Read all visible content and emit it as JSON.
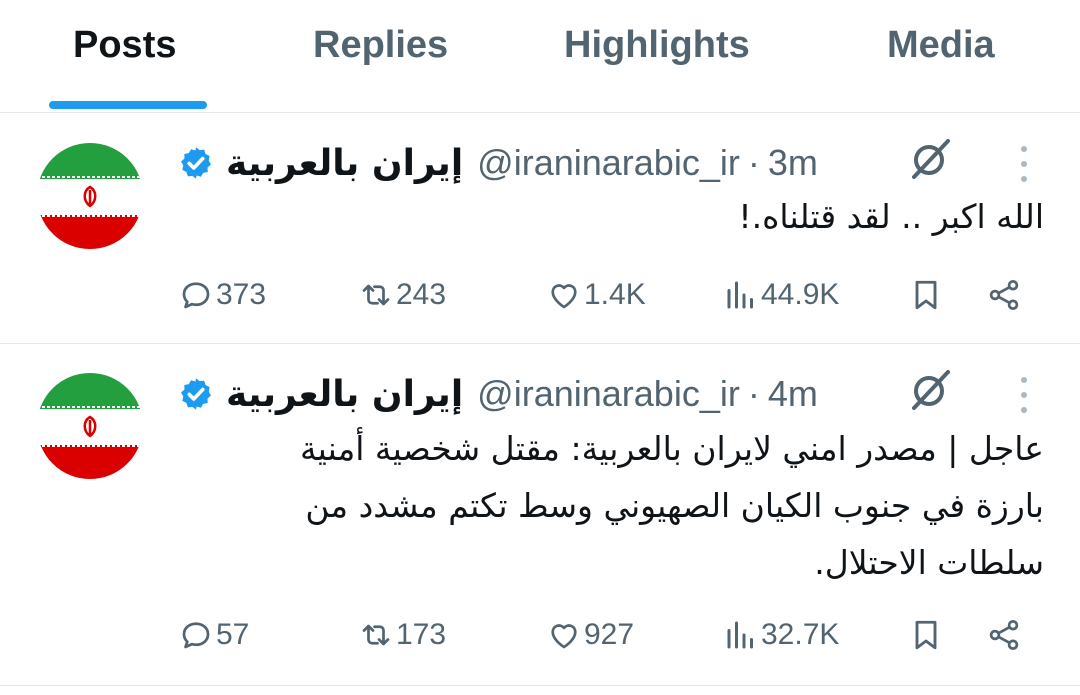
{
  "tabs": [
    {
      "label": "Posts",
      "active": true
    },
    {
      "label": "Replies",
      "active": false
    },
    {
      "label": "Highlights",
      "active": false
    },
    {
      "label": "Media",
      "active": false
    }
  ],
  "colors": {
    "accent": "#1d9bf0",
    "text": "#0f1419",
    "muted": "#536471",
    "flag_green": "#239f40",
    "flag_red": "#da0000"
  },
  "posts": [
    {
      "display_name": "إيران بالعربية",
      "handle": "@iraninarabic_ir",
      "separator": "·",
      "time": "3m",
      "text": "الله اكبر .. لقد قتلناه.!",
      "stats": {
        "replies": "373",
        "reposts": "243",
        "likes": "1.4K",
        "views": "44.9K"
      }
    },
    {
      "display_name": "إيران بالعربية",
      "handle": "@iraninarabic_ir",
      "separator": "·",
      "time": "4m",
      "text": "عاجل | مصدر امني لايران بالعربية: مقتل شخصية أمنية بارزة في جنوب الكيان الصهيوني وسط تكتم مشدد من سلطات الاحتلال.",
      "stats": {
        "replies": "57",
        "reposts": "173",
        "likes": "927",
        "views": "32.7K"
      }
    }
  ],
  "icons": [
    "verified-badge-icon",
    "grok-icon",
    "more-icon",
    "reply-icon",
    "repost-icon",
    "like-icon",
    "views-icon",
    "bookmark-icon",
    "share-icon"
  ]
}
